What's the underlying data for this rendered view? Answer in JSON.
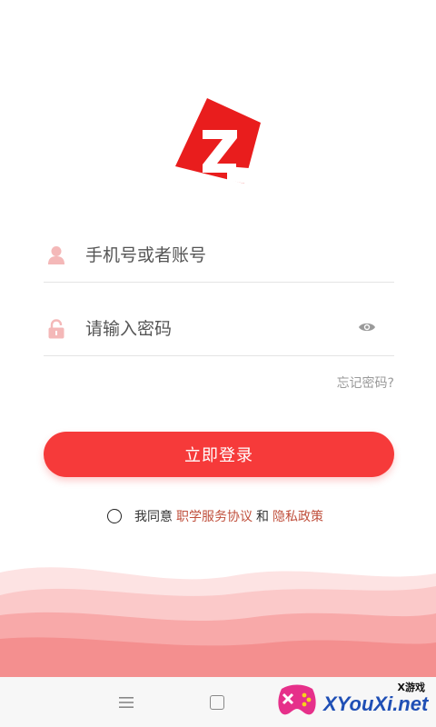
{
  "logo": {
    "letter": "Z",
    "color": "#e91d1d"
  },
  "username_field": {
    "icon": "user-icon",
    "placeholder": "手机号或者账号"
  },
  "password_field": {
    "icon": "lock-icon",
    "placeholder": "请输入密码",
    "toggle_icon": "eye-icon"
  },
  "forgot_password": "忘记密码?",
  "login_button": "立即登录",
  "agreement": {
    "prefix": "我同意",
    "link1": "职学服务协议",
    "joiner": "和",
    "link2": "隐私政策"
  },
  "colors": {
    "accent": "#f63a3a",
    "link": "#c0503d"
  },
  "nav_bar": {
    "menu_icon": "menu-icon",
    "home_icon": "square-home-icon"
  },
  "watermark": {
    "text": "XYouXi.net",
    "tag": "X游戏"
  }
}
